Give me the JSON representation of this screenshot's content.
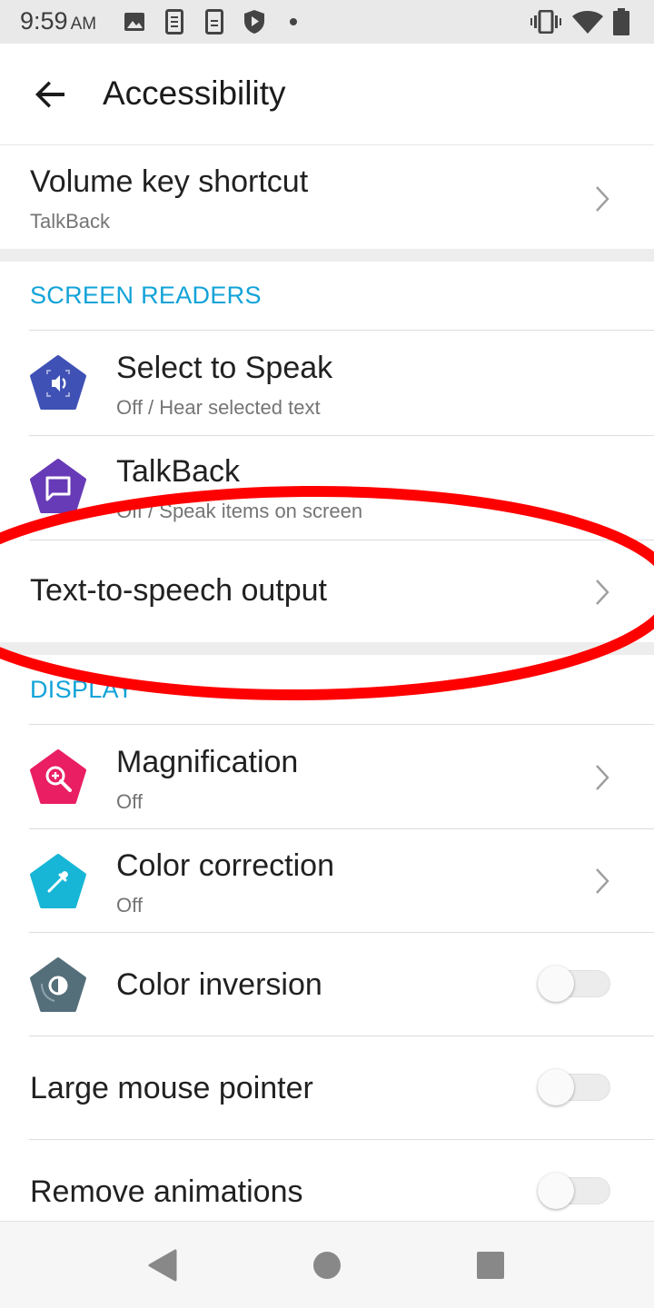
{
  "status_bar": {
    "time": "9:59",
    "ampm": "AM",
    "icons": [
      "image-icon",
      "sim-card-icon",
      "phone-icon",
      "shield-icon",
      "dot-icon",
      "vibrate-icon",
      "wifi-icon",
      "battery-icon"
    ]
  },
  "app_bar": {
    "back_icon": "arrow-back-icon",
    "title": "Accessibility"
  },
  "volume_shortcut": {
    "title": "Volume key shortcut",
    "subtitle": "TalkBack"
  },
  "sections": {
    "screen_readers": "SCREEN READERS",
    "display": "DISPLAY"
  },
  "screen_readers": {
    "select_to_speak": {
      "title": "Select to Speak",
      "subtitle": "Off / Hear selected text",
      "icon": "speaker-icon",
      "color": "#3f51b5"
    },
    "talkback": {
      "title": "TalkBack",
      "subtitle": "Off / Speak items on screen",
      "icon": "message-icon",
      "color": "#673ab7"
    },
    "tts": {
      "title": "Text-to-speech output"
    }
  },
  "display": {
    "magnification": {
      "title": "Magnification",
      "subtitle": "Off",
      "icon": "zoom-in-icon",
      "color": "#e91e63"
    },
    "color_correction": {
      "title": "Color correction",
      "subtitle": "Off",
      "icon": "eyedropper-icon",
      "color": "#17b6d6"
    },
    "color_inversion": {
      "title": "Color inversion",
      "icon": "invert-colors-icon",
      "color": "#546e7a",
      "enabled": false
    },
    "large_mouse_pointer": {
      "title": "Large mouse pointer",
      "enabled": false
    },
    "remove_animations": {
      "title": "Remove animations",
      "enabled": false
    }
  },
  "nav_bar": {
    "back": "nav-back-icon",
    "home": "nav-home-icon",
    "recents": "nav-recents-icon"
  },
  "colors": {
    "accent": "#12a3d8",
    "annotation": "#ff0000"
  }
}
